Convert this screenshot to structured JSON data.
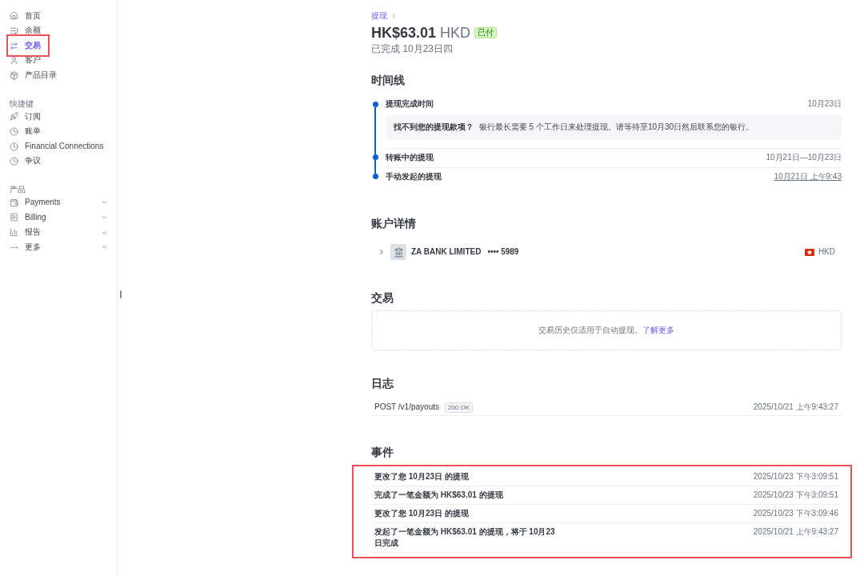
{
  "sidebar": {
    "main_items": [
      {
        "label": "首页",
        "selected": false,
        "highlighted": false
      },
      {
        "label": "余额",
        "selected": false,
        "highlighted": false
      },
      {
        "label": "交易",
        "selected": true,
        "highlighted": true
      },
      {
        "label": "客户",
        "selected": false,
        "highlighted": false
      },
      {
        "label": "产品目录",
        "selected": false,
        "highlighted": false
      }
    ],
    "sections": [
      {
        "title": "快捷键",
        "items": [
          {
            "label": "订阅",
            "selected": false
          },
          {
            "label": "账单",
            "selected": false
          },
          {
            "label": "Financial Connections",
            "selected": false
          },
          {
            "label": "争议",
            "selected": false
          }
        ]
      },
      {
        "title": "产品",
        "items": [
          {
            "label": "Payments",
            "selected": false,
            "expanded": false
          },
          {
            "label": "Billing",
            "selected": false,
            "expanded": false
          },
          {
            "label": "报告",
            "selected": false,
            "expanded": false
          },
          {
            "label": "更多",
            "selected": false,
            "expanded": false
          }
        ]
      }
    ]
  },
  "breadcrumb": {
    "label": "提现"
  },
  "header": {
    "amount": "HK$63.01",
    "currency": "HKD",
    "status": "已付",
    "subtitle": "已完成 10月23日四"
  },
  "timeline": {
    "title": "时间线",
    "items": [
      {
        "label": "提现完成时间",
        "time": "10月23日",
        "linked": false,
        "note": "**找不到您的提现款项？** 银行最长需要 5 个工作日来处理提现。请等待至10月30日然后联系您的银行。"
      },
      {
        "label": "转账中的提现",
        "time": "10月21日—10月23日",
        "linked": false
      },
      {
        "label": "手动发起的提现",
        "time": "10月21日 上午9:43",
        "linked": true
      }
    ]
  },
  "account_details": {
    "title": "账户详情",
    "bank": {
      "expanded": false,
      "name": "ZA BANK LIMITED",
      "account": "•••• 5989",
      "currency": "HKD"
    }
  },
  "transactions": {
    "title": "交易",
    "empty_text": "交易历史仅适用于自动提现。",
    "link": "了解更多"
  },
  "logs": {
    "title": "日志",
    "rows": [
      {
        "request": "POST /v1/payouts",
        "status": "200 OK",
        "time": "2025/10/21 上午9:43:27"
      }
    ]
  },
  "events": {
    "title": "事件",
    "highlighted": true,
    "rows": [
      {
        "text": "更改了您 10月23日 的提现",
        "time": "2025/10/23 下午3:09:51"
      },
      {
        "text": "完成了一笔金额为 HK$63.01 的提现",
        "time": "2025/10/23 下午3:09:51"
      },
      {
        "text": "更改了您 10月23日 的提现",
        "time": "2025/10/23 下午3:09:46"
      },
      {
        "text": "发起了一笔金额为 HK$63.01 的提现，将于 10月23日完成",
        "time": "2025/10/21 上午9:43:27"
      }
    ]
  }
}
